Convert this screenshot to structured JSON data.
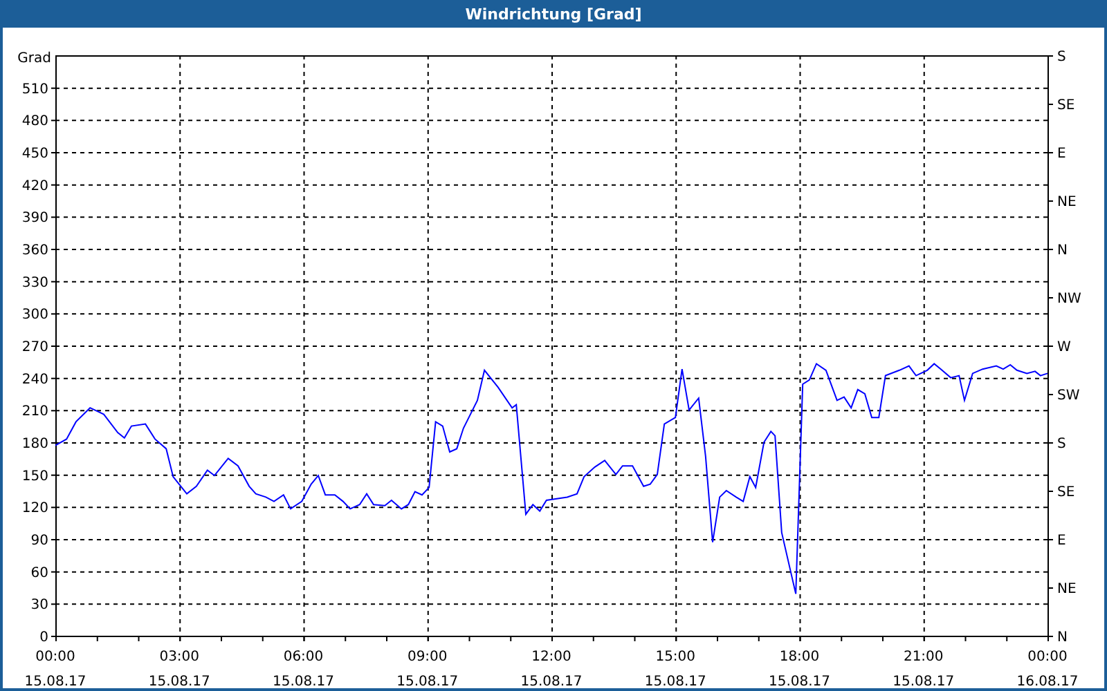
{
  "chart_data": {
    "type": "line",
    "title": "Windrichtung [Grad]",
    "ylabel": "Grad",
    "xlim": [
      0,
      24
    ],
    "ylim": [
      0,
      540
    ],
    "xticks": [
      {
        "value": 0,
        "label": "00:00"
      },
      {
        "value": 3,
        "label": "03:00"
      },
      {
        "value": 6,
        "label": "06:00"
      },
      {
        "value": 9,
        "label": "09:00"
      },
      {
        "value": 12,
        "label": "12:00"
      },
      {
        "value": 15,
        "label": "15:00"
      },
      {
        "value": 18,
        "label": "18:00"
      },
      {
        "value": 21,
        "label": "21:00"
      },
      {
        "value": 24,
        "label": "00:00"
      }
    ],
    "yticks": [
      {
        "value": 0,
        "label": "0"
      },
      {
        "value": 30,
        "label": "30"
      },
      {
        "value": 60,
        "label": "60"
      },
      {
        "value": 90,
        "label": "90"
      },
      {
        "value": 120,
        "label": "120"
      },
      {
        "value": 150,
        "label": "150"
      },
      {
        "value": 180,
        "label": "180"
      },
      {
        "value": 210,
        "label": "210"
      },
      {
        "value": 240,
        "label": "240"
      },
      {
        "value": 270,
        "label": "270"
      },
      {
        "value": 300,
        "label": "300"
      },
      {
        "value": 330,
        "label": "330"
      },
      {
        "value": 360,
        "label": "360"
      },
      {
        "value": 390,
        "label": "390"
      },
      {
        "value": 420,
        "label": "420"
      },
      {
        "value": 450,
        "label": "450"
      },
      {
        "value": 480,
        "label": "480"
      },
      {
        "value": 510,
        "label": "510"
      }
    ],
    "grid": true,
    "y2ticks": [
      "N",
      "NE",
      "E",
      "SE",
      "S",
      "SW",
      "W",
      "NW",
      "N",
      "NE",
      "E",
      "SE",
      "S"
    ],
    "x": [
      0,
      0.27,
      0.5,
      0.84,
      1.17,
      1.51,
      1.67,
      1.84,
      2.18,
      2.41,
      2.68,
      2.85,
      3.18,
      3.41,
      3.68,
      3.85,
      4.18,
      4.42,
      4.69,
      4.85,
      5.09,
      5.29,
      5.52,
      5.69,
      5.96,
      6.19,
      6.36,
      6.53,
      6.76,
      6.96,
      7.13,
      7.36,
      7.53,
      7.7,
      7.97,
      8.13,
      8.37,
      8.54,
      8.7,
      8.87,
      9.04,
      9.2,
      9.37,
      9.54,
      9.71,
      9.87,
      10.21,
      10.38,
      10.71,
      11.05,
      11.15,
      11.38,
      11.55,
      11.72,
      11.88,
      12.38,
      12.62,
      12.79,
      13.05,
      13.29,
      13.56,
      13.72,
      13.96,
      14.23,
      14.39,
      14.56,
      14.73,
      15.0,
      15.16,
      15.33,
      15.56,
      15.73,
      15.9,
      16.07,
      16.23,
      16.47,
      16.64,
      16.8,
      16.94,
      17.14,
      17.31,
      17.41,
      17.57,
      17.91,
      18.08,
      18.24,
      18.41,
      18.64,
      18.91,
      19.08,
      19.25,
      19.41,
      19.58,
      19.75,
      19.92,
      20.08,
      20.42,
      20.65,
      20.82,
      21.09,
      21.26,
      21.42,
      21.66,
      21.86,
      21.99,
      22.19,
      22.43,
      22.76,
      22.93,
      23.1,
      23.26,
      23.5,
      23.7,
      23.83,
      24
    ],
    "series": [
      {
        "color": "#0000ff",
        "values": [
          177,
          183,
          199,
          212,
          206,
          189,
          184,
          195,
          197,
          183,
          174,
          148,
          132,
          139,
          154,
          149,
          165,
          158,
          139,
          132,
          129,
          125,
          131,
          118,
          125,
          141,
          149,
          131,
          131,
          125,
          118,
          122,
          132,
          122,
          121,
          126,
          118,
          122,
          134,
          131,
          138,
          199,
          195,
          171,
          174,
          193,
          219,
          247,
          231,
          212,
          215,
          113,
          122,
          116,
          126,
          129,
          132,
          148,
          157,
          163,
          150,
          158,
          158,
          139,
          141,
          150,
          197,
          203,
          248,
          210,
          221,
          167,
          87,
          129,
          135,
          129,
          125,
          148,
          138,
          180,
          190,
          186,
          96,
          39,
          234,
          238,
          253,
          247,
          219,
          222,
          212,
          229,
          225,
          203,
          203,
          242,
          247,
          251,
          242,
          247,
          253,
          248,
          240,
          242,
          219,
          244,
          248,
          251,
          248,
          252,
          247,
          244,
          246,
          242,
          244
        ]
      }
    ]
  },
  "x_axis_dates": [
    "15.08.17",
    "15.08.17",
    "15.08.17",
    "15.08.17",
    "15.08.17",
    "15.08.17",
    "15.08.17",
    "15.08.17",
    "16.08.17"
  ]
}
